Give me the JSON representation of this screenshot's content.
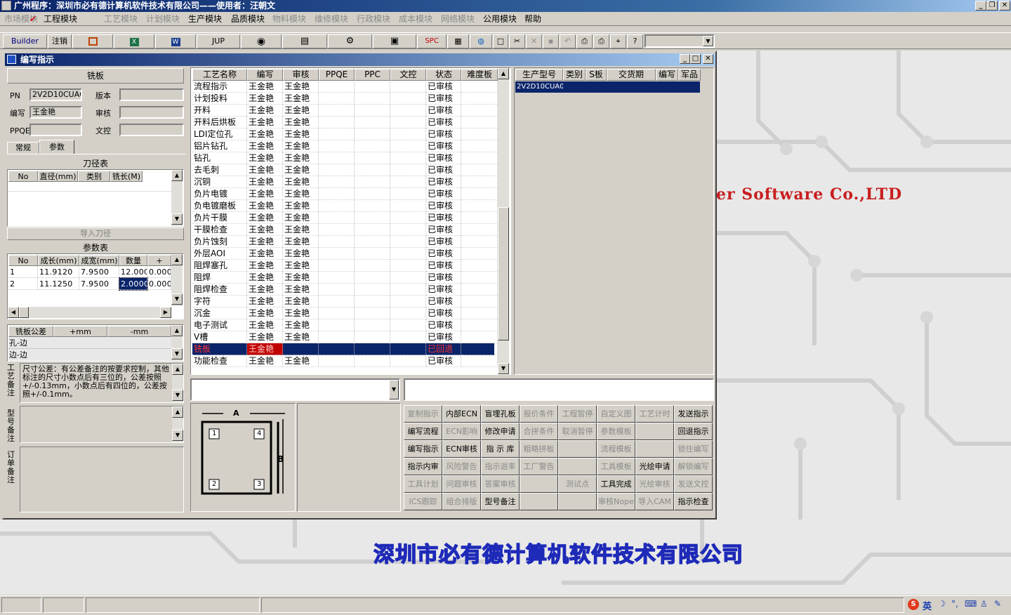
{
  "app_title": "广州程序：深圳市必有德计算机软件技术有限公司——使用者：汪朝文",
  "menus": [
    {
      "label": "市场模块",
      "enabled": false
    },
    {
      "label": "工程模块",
      "enabled": true,
      "checked": true
    },
    {
      "label": "工艺模块",
      "enabled": false
    },
    {
      "label": "计划模块",
      "enabled": false
    },
    {
      "label": "生产模块",
      "enabled": true
    },
    {
      "label": "品质模块",
      "enabled": true
    },
    {
      "label": "物料模块",
      "enabled": false
    },
    {
      "label": "维修模块",
      "enabled": false
    },
    {
      "label": "行政模块",
      "enabled": false
    },
    {
      "label": "成本模块",
      "enabled": false
    },
    {
      "label": "网络模块",
      "enabled": false
    },
    {
      "label": "公用模块",
      "enabled": true
    },
    {
      "label": "帮助",
      "enabled": true
    }
  ],
  "toolbar": {
    "builder": "Builder",
    "logout": "注销",
    "jup": "JUP",
    "spc": "SPC"
  },
  "child_title": "编写指示",
  "left": {
    "header": "铣板",
    "pn_label": "PN",
    "pn_value": "2V2D10CUA0",
    "version_label": "版本",
    "version_value": "",
    "author_label": "编写",
    "author_value": "王金艳",
    "review_label": "审核",
    "review_value": "",
    "ppqe_label": "PPQE",
    "ppqe_value": "",
    "doc_label": "文控",
    "doc_value": "",
    "tab_normal": "常规",
    "tab_params": "参数",
    "tool_table_title": "刀径表",
    "tool_cols": [
      "No",
      "直径(mm)",
      "类别",
      "铣长(M)"
    ],
    "import_tools": "导入刀径",
    "param_table_title": "参数表",
    "param_cols": [
      "No",
      "成长(mm)",
      "成宽(mm)",
      "数量",
      "+"
    ],
    "param_rows": [
      {
        "no": "1",
        "len": "11.9120",
        "wid": "7.9500",
        "qty": "12.0000",
        "plus": "0.000"
      },
      {
        "no": "2",
        "len": "11.1250",
        "wid": "7.9500",
        "qty": "2.0000",
        "plus": "0.000"
      }
    ],
    "tol_cols": [
      "铣板公差",
      "+mm",
      "-mm"
    ],
    "tol_rows": [
      "孔-边",
      "边-边"
    ],
    "process_note_label": "工艺备注",
    "process_note": "尺寸公差：有公差备注的按要求控制，其他标注的尺寸小数点后有三位的，公差按照+/-0.13mm，小数点后有四位的，公差按照+/-0.1mm。",
    "model_note_label": "型号备注",
    "order_note_label": "订单备注"
  },
  "process_table": {
    "cols": [
      "工艺名称",
      "编写",
      "审核",
      "PPQE",
      "PPC",
      "文控",
      "状态",
      "难度板"
    ],
    "rows": [
      {
        "name": "流程指示",
        "author": "王金艳",
        "review": "王金艳",
        "status": "已审核"
      },
      {
        "name": "计划投料",
        "author": "王金艳",
        "review": "王金艳",
        "status": "已审核"
      },
      {
        "name": "开料",
        "author": "王金艳",
        "review": "王金艳",
        "status": "已审核"
      },
      {
        "name": "开料后烘板",
        "author": "王金艳",
        "review": "王金艳",
        "status": "已审核"
      },
      {
        "name": "LDI定位孔",
        "author": "王金艳",
        "review": "王金艳",
        "status": "已审核"
      },
      {
        "name": "铝片钻孔",
        "author": "王金艳",
        "review": "王金艳",
        "status": "已审核"
      },
      {
        "name": "钻孔",
        "author": "王金艳",
        "review": "王金艳",
        "status": "已审核"
      },
      {
        "name": "去毛刺",
        "author": "王金艳",
        "review": "王金艳",
        "status": "已审核"
      },
      {
        "name": "沉铜",
        "author": "王金艳",
        "review": "王金艳",
        "status": "已审核"
      },
      {
        "name": "负片电镀",
        "author": "王金艳",
        "review": "王金艳",
        "status": "已审核"
      },
      {
        "name": "负电镀磨板",
        "author": "王金艳",
        "review": "王金艳",
        "status": "已审核"
      },
      {
        "name": "负片干膜",
        "author": "王金艳",
        "review": "王金艳",
        "status": "已审核"
      },
      {
        "name": "干膜检查",
        "author": "王金艳",
        "review": "王金艳",
        "status": "已审核"
      },
      {
        "name": "负片蚀刻",
        "author": "王金艳",
        "review": "王金艳",
        "status": "已审核"
      },
      {
        "name": "外层AOI",
        "author": "王金艳",
        "review": "王金艳",
        "status": "已审核"
      },
      {
        "name": "阻焊塞孔",
        "author": "王金艳",
        "review": "王金艳",
        "status": "已审核"
      },
      {
        "name": "阻焊",
        "author": "王金艳",
        "review": "王金艳",
        "status": "已审核"
      },
      {
        "name": "阻焊检查",
        "author": "王金艳",
        "review": "王金艳",
        "status": "已审核"
      },
      {
        "name": "字符",
        "author": "王金艳",
        "review": "王金艳",
        "status": "已审核"
      },
      {
        "name": "沉金",
        "author": "王金艳",
        "review": "王金艳",
        "status": "已审核"
      },
      {
        "name": "电子测试",
        "author": "王金艳",
        "review": "王金艳",
        "status": "已审核"
      },
      {
        "name": "V槽",
        "author": "王金艳",
        "review": "王金艳",
        "status": "已审核"
      },
      {
        "name": "铣板",
        "author": "王金艳",
        "review": "",
        "status": "已回退",
        "selected": true
      },
      {
        "name": "功能检查",
        "author": "王金艳",
        "review": "王金艳",
        "status": "已审核"
      }
    ]
  },
  "model_table": {
    "cols": [
      "生产型号",
      "类别",
      "S板",
      "交货期",
      "编写",
      "军品"
    ],
    "rows": [
      {
        "model": "2V2D10CUA0"
      }
    ]
  },
  "diagram": {
    "a": "A",
    "b": "B",
    "n1": "1",
    "n2": "2",
    "n3": "3",
    "n4": "4"
  },
  "actions": [
    [
      "复制指示",
      "内部ECN",
      "盲埋孔板",
      "报价条件",
      "工程暂停",
      "自定义图",
      "工艺计时",
      "发送指示"
    ],
    [
      "编写流程",
      "ECN影响",
      "修改申请",
      "合拼条件",
      "取消暂停",
      "参数模板",
      "",
      "回退指示"
    ],
    [
      "编写指示",
      "ECN审核",
      "指 示 库",
      "粗略拼板",
      "",
      "流程模板",
      "",
      "锁住编写"
    ],
    [
      "指示内审",
      "风险警告",
      "指示退率",
      "工厂警告",
      "",
      "工具模板",
      "光绘申请",
      "解锁编写"
    ],
    [
      "工具计划",
      "问题审核",
      "答案审核",
      "",
      "测试点",
      "工具完成",
      "光绘审核",
      "发送文控"
    ],
    [
      "ICS跟踪",
      "组合排版",
      "型号备注",
      "",
      "",
      "审核Nope",
      "导入CAM",
      "指示检查"
    ]
  ],
  "actions_enabled": [
    [
      false,
      true,
      true,
      false,
      false,
      false,
      false,
      true
    ],
    [
      true,
      false,
      true,
      false,
      false,
      false,
      false,
      true
    ],
    [
      true,
      true,
      true,
      false,
      false,
      false,
      false,
      false
    ],
    [
      true,
      false,
      false,
      false,
      false,
      false,
      true,
      false
    ],
    [
      false,
      false,
      false,
      false,
      false,
      true,
      false,
      false
    ],
    [
      false,
      false,
      true,
      false,
      false,
      false,
      false,
      true
    ]
  ],
  "background_text": {
    "software": "er Software Co.,LTD",
    "company": "深圳市必有德计算机软件技术有限公司"
  },
  "tray": {
    "ime": "英"
  }
}
